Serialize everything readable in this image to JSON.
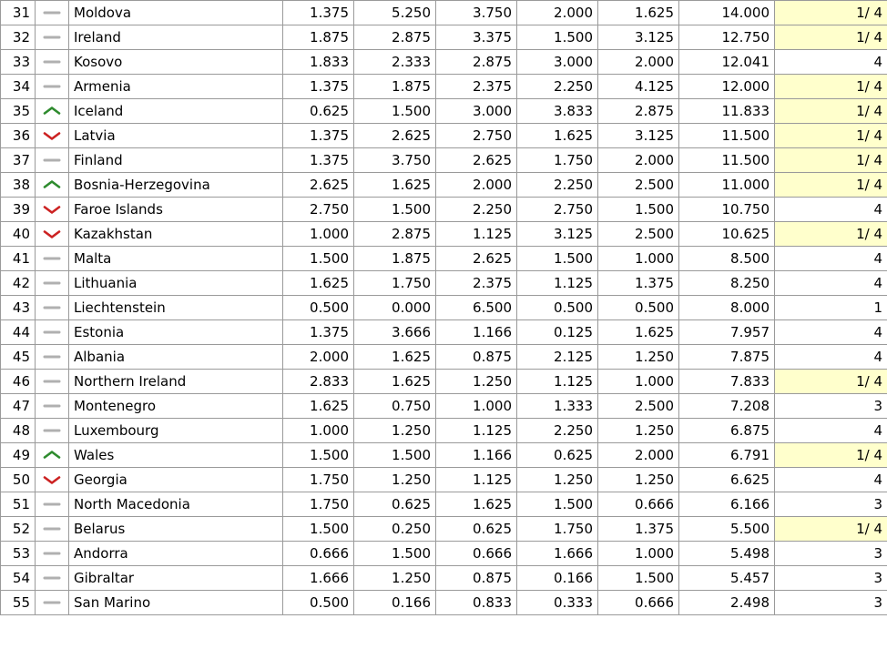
{
  "table": {
    "icons": {
      "same": "trend-same-icon",
      "up": "trend-up-icon",
      "down": "trend-down-icon"
    },
    "colors": {
      "trend_up": "#2e8b2e",
      "trend_down": "#cc2222",
      "trend_same": "#b0b0b0",
      "highlight_bg": "#ffffcc",
      "grid_border": "#9a9a9a",
      "text": "#000000"
    },
    "rows": [
      {
        "rank": "31",
        "trend": "same",
        "team": "Moldova",
        "v1": "1.375",
        "v2": "5.250",
        "v3": "3.750",
        "v4": "2.000",
        "v5": "1.625",
        "total": "14.000",
        "tag": "1/ 4",
        "highlight": true
      },
      {
        "rank": "32",
        "trend": "same",
        "team": "Ireland",
        "v1": "1.875",
        "v2": "2.875",
        "v3": "3.375",
        "v4": "1.500",
        "v5": "3.125",
        "total": "12.750",
        "tag": "1/ 4",
        "highlight": true
      },
      {
        "rank": "33",
        "trend": "same",
        "team": "Kosovo",
        "v1": "1.833",
        "v2": "2.333",
        "v3": "2.875",
        "v4": "3.000",
        "v5": "2.000",
        "total": "12.041",
        "tag": "4",
        "highlight": false
      },
      {
        "rank": "34",
        "trend": "same",
        "team": "Armenia",
        "v1": "1.375",
        "v2": "1.875",
        "v3": "2.375",
        "v4": "2.250",
        "v5": "4.125",
        "total": "12.000",
        "tag": "1/ 4",
        "highlight": true
      },
      {
        "rank": "35",
        "trend": "up",
        "team": "Iceland",
        "v1": "0.625",
        "v2": "1.500",
        "v3": "3.000",
        "v4": "3.833",
        "v5": "2.875",
        "total": "11.833",
        "tag": "1/ 4",
        "highlight": true
      },
      {
        "rank": "36",
        "trend": "down",
        "team": "Latvia",
        "v1": "1.375",
        "v2": "2.625",
        "v3": "2.750",
        "v4": "1.625",
        "v5": "3.125",
        "total": "11.500",
        "tag": "1/ 4",
        "highlight": true
      },
      {
        "rank": "37",
        "trend": "same",
        "team": "Finland",
        "v1": "1.375",
        "v2": "3.750",
        "v3": "2.625",
        "v4": "1.750",
        "v5": "2.000",
        "total": "11.500",
        "tag": "1/ 4",
        "highlight": true
      },
      {
        "rank": "38",
        "trend": "up",
        "team": "Bosnia-Herzegovina",
        "v1": "2.625",
        "v2": "1.625",
        "v3": "2.000",
        "v4": "2.250",
        "v5": "2.500",
        "total": "11.000",
        "tag": "1/ 4",
        "highlight": true
      },
      {
        "rank": "39",
        "trend": "down",
        "team": "Faroe Islands",
        "v1": "2.750",
        "v2": "1.500",
        "v3": "2.250",
        "v4": "2.750",
        "v5": "1.500",
        "total": "10.750",
        "tag": "4",
        "highlight": false
      },
      {
        "rank": "40",
        "trend": "down",
        "team": "Kazakhstan",
        "v1": "1.000",
        "v2": "2.875",
        "v3": "1.125",
        "v4": "3.125",
        "v5": "2.500",
        "total": "10.625",
        "tag": "1/ 4",
        "highlight": true
      },
      {
        "rank": "41",
        "trend": "same",
        "team": "Malta",
        "v1": "1.500",
        "v2": "1.875",
        "v3": "2.625",
        "v4": "1.500",
        "v5": "1.000",
        "total": "8.500",
        "tag": "4",
        "highlight": false
      },
      {
        "rank": "42",
        "trend": "same",
        "team": "Lithuania",
        "v1": "1.625",
        "v2": "1.750",
        "v3": "2.375",
        "v4": "1.125",
        "v5": "1.375",
        "total": "8.250",
        "tag": "4",
        "highlight": false
      },
      {
        "rank": "43",
        "trend": "same",
        "team": "Liechtenstein",
        "v1": "0.500",
        "v2": "0.000",
        "v3": "6.500",
        "v4": "0.500",
        "v5": "0.500",
        "total": "8.000",
        "tag": "1",
        "highlight": false
      },
      {
        "rank": "44",
        "trend": "same",
        "team": "Estonia",
        "v1": "1.375",
        "v2": "3.666",
        "v3": "1.166",
        "v4": "0.125",
        "v5": "1.625",
        "total": "7.957",
        "tag": "4",
        "highlight": false
      },
      {
        "rank": "45",
        "trend": "same",
        "team": "Albania",
        "v1": "2.000",
        "v2": "1.625",
        "v3": "0.875",
        "v4": "2.125",
        "v5": "1.250",
        "total": "7.875",
        "tag": "4",
        "highlight": false
      },
      {
        "rank": "46",
        "trend": "same",
        "team": "Northern Ireland",
        "v1": "2.833",
        "v2": "1.625",
        "v3": "1.250",
        "v4": "1.125",
        "v5": "1.000",
        "total": "7.833",
        "tag": "1/ 4",
        "highlight": true
      },
      {
        "rank": "47",
        "trend": "same",
        "team": "Montenegro",
        "v1": "1.625",
        "v2": "0.750",
        "v3": "1.000",
        "v4": "1.333",
        "v5": "2.500",
        "total": "7.208",
        "tag": "3",
        "highlight": false
      },
      {
        "rank": "48",
        "trend": "same",
        "team": "Luxembourg",
        "v1": "1.000",
        "v2": "1.250",
        "v3": "1.125",
        "v4": "2.250",
        "v5": "1.250",
        "total": "6.875",
        "tag": "4",
        "highlight": false
      },
      {
        "rank": "49",
        "trend": "up",
        "team": "Wales",
        "v1": "1.500",
        "v2": "1.500",
        "v3": "1.166",
        "v4": "0.625",
        "v5": "2.000",
        "total": "6.791",
        "tag": "1/ 4",
        "highlight": true
      },
      {
        "rank": "50",
        "trend": "down",
        "team": "Georgia",
        "v1": "1.750",
        "v2": "1.250",
        "v3": "1.125",
        "v4": "1.250",
        "v5": "1.250",
        "total": "6.625",
        "tag": "4",
        "highlight": false
      },
      {
        "rank": "51",
        "trend": "same",
        "team": "North Macedonia",
        "v1": "1.750",
        "v2": "0.625",
        "v3": "1.625",
        "v4": "1.500",
        "v5": "0.666",
        "total": "6.166",
        "tag": "3",
        "highlight": false
      },
      {
        "rank": "52",
        "trend": "same",
        "team": "Belarus",
        "v1": "1.500",
        "v2": "0.250",
        "v3": "0.625",
        "v4": "1.750",
        "v5": "1.375",
        "total": "5.500",
        "tag": "1/ 4",
        "highlight": true
      },
      {
        "rank": "53",
        "trend": "same",
        "team": "Andorra",
        "v1": "0.666",
        "v2": "1.500",
        "v3": "0.666",
        "v4": "1.666",
        "v5": "1.000",
        "total": "5.498",
        "tag": "3",
        "highlight": false
      },
      {
        "rank": "54",
        "trend": "same",
        "team": "Gibraltar",
        "v1": "1.666",
        "v2": "1.250",
        "v3": "0.875",
        "v4": "0.166",
        "v5": "1.500",
        "total": "5.457",
        "tag": "3",
        "highlight": false
      },
      {
        "rank": "55",
        "trend": "same",
        "team": "San Marino",
        "v1": "0.500",
        "v2": "0.166",
        "v3": "0.833",
        "v4": "0.333",
        "v5": "0.666",
        "total": "2.498",
        "tag": "3",
        "highlight": false
      }
    ]
  }
}
